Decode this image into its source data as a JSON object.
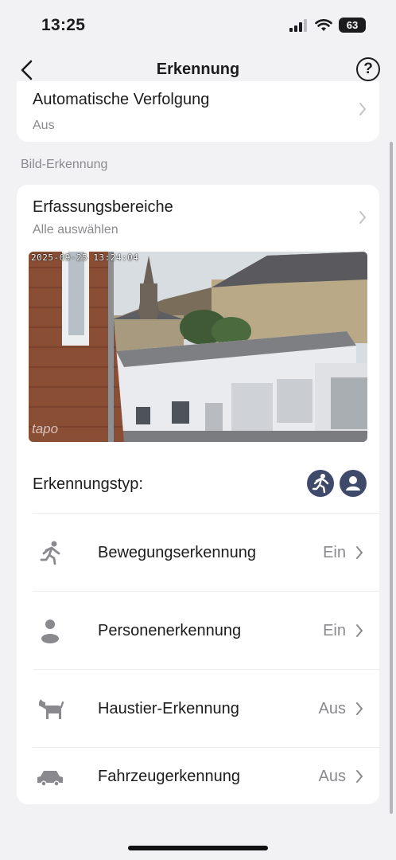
{
  "status": {
    "time": "13:25",
    "battery": "63"
  },
  "header": {
    "title": "Erkennung",
    "help_label": "?"
  },
  "auto_tracking": {
    "title": "Automatische Verfolgung",
    "value": "Aus"
  },
  "section": {
    "label": "Bild-Erkennung"
  },
  "detection_area": {
    "title": "Erfassungsbereiche",
    "subtitle": "Alle auswählen"
  },
  "camera": {
    "timestamp": "2025-09-25 13:24:04",
    "watermark": "tapo"
  },
  "detection_type": {
    "label": "Erkennungstyp:"
  },
  "detections": [
    {
      "icon": "motion-icon",
      "label": "Bewegungserkennung",
      "value": "Ein"
    },
    {
      "icon": "person-icon",
      "label": "Personenerkennung",
      "value": "Ein"
    },
    {
      "icon": "pet-icon",
      "label": "Haustier-Erkennung",
      "value": "Aus"
    },
    {
      "icon": "vehicle-icon",
      "label": "Fahrzeugerkennung",
      "value": "Aus"
    }
  ],
  "colors": {
    "accent_badge": "#3f4a6b",
    "icon_gray": "#8a8a8e",
    "background": "#f2f2f4"
  }
}
